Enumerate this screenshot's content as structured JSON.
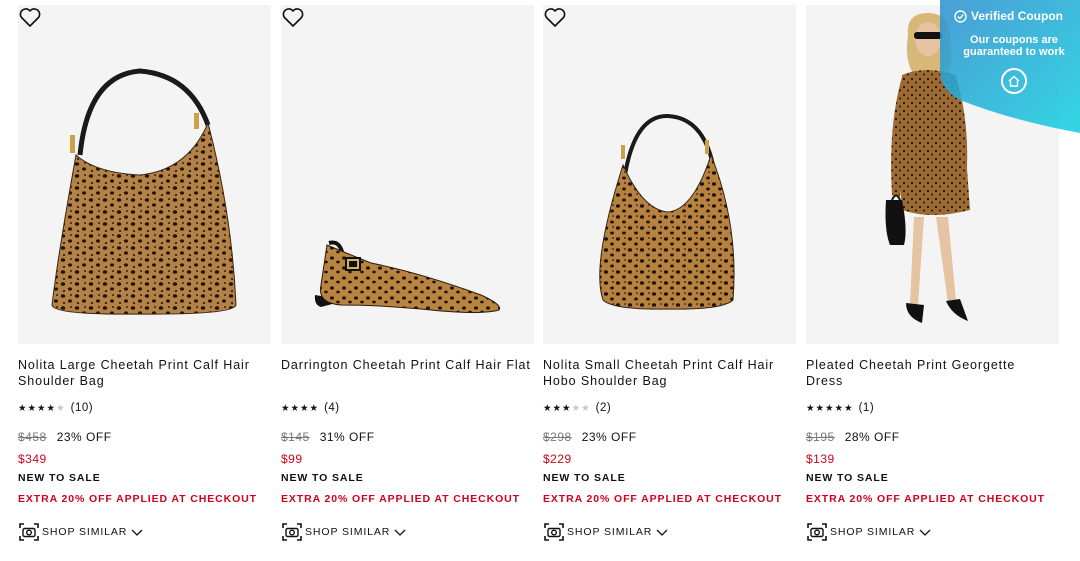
{
  "products": [
    {
      "title": "Nolita Large Cheetah Print Calf Hair Shoulder Bag",
      "stars_on": "★★★★",
      "stars_off": "★",
      "rating_value": 4,
      "review_count": "(10)",
      "original_price": "$458",
      "discount": "23% OFF",
      "sale_price": "$349",
      "badge": "NEW TO SALE",
      "promo": "EXTRA 20% OFF APPLIED AT CHECKOUT",
      "shop_similar": "SHOP SIMILAR",
      "image_icon": "shoulder-bag-image"
    },
    {
      "title": "Darrington Cheetah Print Calf Hair Flat",
      "stars_on": "★★★★",
      "stars_off": "",
      "rating_value": 4,
      "review_count": "(4)",
      "original_price": "$145",
      "discount": "31% OFF",
      "sale_price": "$99",
      "badge": "NEW TO SALE",
      "promo": "EXTRA 20% OFF APPLIED AT CHECKOUT",
      "shop_similar": "SHOP SIMILAR",
      "image_icon": "slingback-flat-image"
    },
    {
      "title": "Nolita Small Cheetah Print Calf Hair Hobo Shoulder Bag",
      "stars_on": "★★★",
      "stars_off": "★★",
      "rating_value": 3,
      "review_count": "(2)",
      "original_price": "$298",
      "discount": "23% OFF",
      "sale_price": "$229",
      "badge": "NEW TO SALE",
      "promo": "EXTRA 20% OFF APPLIED AT CHECKOUT",
      "shop_similar": "SHOP SIMILAR",
      "image_icon": "hobo-bag-image"
    },
    {
      "title": "Pleated Cheetah Print Georgette Dress",
      "stars_on": "★★★★★",
      "stars_off": "",
      "rating_value": 5,
      "review_count": "(1)",
      "original_price": "$195",
      "discount": "28% OFF",
      "sale_price": "$139",
      "badge": "NEW TO SALE",
      "promo": "EXTRA 20% OFF APPLIED AT CHECKOUT",
      "shop_similar": "SHOP SIMILAR",
      "image_icon": "model-dress-image"
    }
  ],
  "coupon": {
    "title": "Verified Coupon",
    "text": "Our coupons are guaranteed to work",
    "accent": "#1fb5d6"
  },
  "colors": {
    "sale_red": "#d0021b",
    "image_bg": "#f4f4f4",
    "leopard_base": "#b07a3c"
  }
}
